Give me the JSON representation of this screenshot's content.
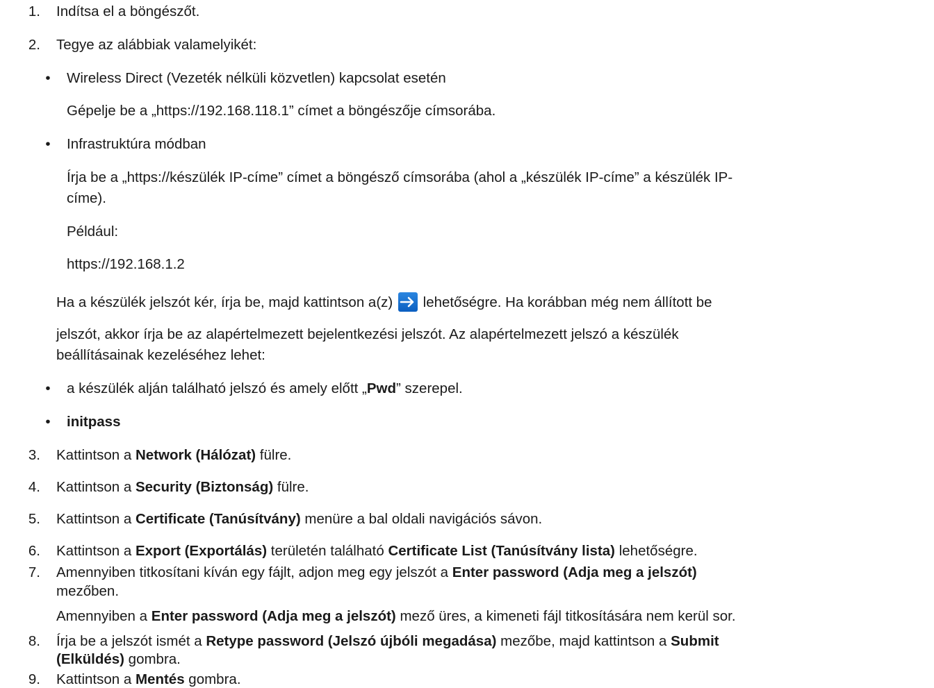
{
  "steps": [
    {
      "n": "1",
      "text": "Indítsa el a böngészőt."
    },
    {
      "n": "2",
      "text": "Tegye az alábbiak valamelyikét:"
    },
    {
      "n": "3",
      "pre": "Kattintson a ",
      "bold": "Network (Hálózat)",
      "post": " fülre."
    },
    {
      "n": "4",
      "pre": "Kattintson a ",
      "bold": "Security (Biztonság)",
      "post": " fülre."
    },
    {
      "n": "5",
      "pre": "Kattintson a ",
      "bold": "Certificate (Tanúsítvány)",
      "post": " menüre a bal oldali navigációs sávon."
    },
    {
      "n": "6",
      "pre": "Kattintson a ",
      "bold": "Export (Exportálás)",
      "mid": " területén található ",
      "bold2": "Certificate List (Tanúsítvány lista)",
      "post": " lehetőségre."
    },
    {
      "n": "7",
      "pre": "Amennyiben titkosítani kíván egy fájlt, adjon meg egy jelszót a ",
      "bold": "Enter password (Adja meg a jelszót)",
      "line2": "mezőben."
    },
    {
      "n": "8",
      "pre": "Írja be a jelszót ismét a ",
      "bold": "Retype password (Jelszó újbóli megadása)",
      "mid": " mezőbe, majd kattintson a ",
      "bold2": "Submit",
      "line2_bold": "(Elküldés)",
      "line2": " gombra."
    },
    {
      "n": "9",
      "pre": "Kattintson a ",
      "bold": "Mentés",
      "post": " gombra."
    }
  ],
  "step2": {
    "wireless_title": "Wireless Direct (Vezeték nélküli közvetlen) kapcsolat esetén",
    "wireless_text": "Gépelje be a „https://192.168.118.1” címet a böngészője címsorába.",
    "infra_title": "Infrastruktúra módban",
    "infra_text_1": "Írja be a „https://készülék IP-címe” címet a böngésző címsorába (ahol a „készülék IP-címe” a készülék IP-",
    "infra_text_2": "címe).",
    "example_label": "Például:",
    "example_url": "https://192.168.1.2",
    "password_text_pre": "Ha a készülék jelszót kér, írja be, majd kattintson a(z) ",
    "password_text_post": " lehetőségre. Ha korábban még nem állított be",
    "password_line2": "jelszót, akkor írja be az alapértelmezett bejelentkezési jelszót. Az alapértelmezett jelszó a készülék",
    "password_line3": "beállításainak kezeléséhez lehet:",
    "pwd_pre": "a készülék alján található jelszó és amely előtt „",
    "pwd_bold": "Pwd",
    "pwd_post": "” szerepel.",
    "initpass": "initpass"
  },
  "step7_note_pre": "Amennyiben a ",
  "step7_note_bold": "Enter password (Adja meg a jelszót)",
  "step7_note_post": " mező üres, a kimeneti fájl titkosítására nem kerül sor.",
  "icons": {
    "login_arrow": "arrow-right-icon"
  },
  "colors": {
    "text": "#1a1a1a",
    "icon_blue": "#1a73d9"
  }
}
